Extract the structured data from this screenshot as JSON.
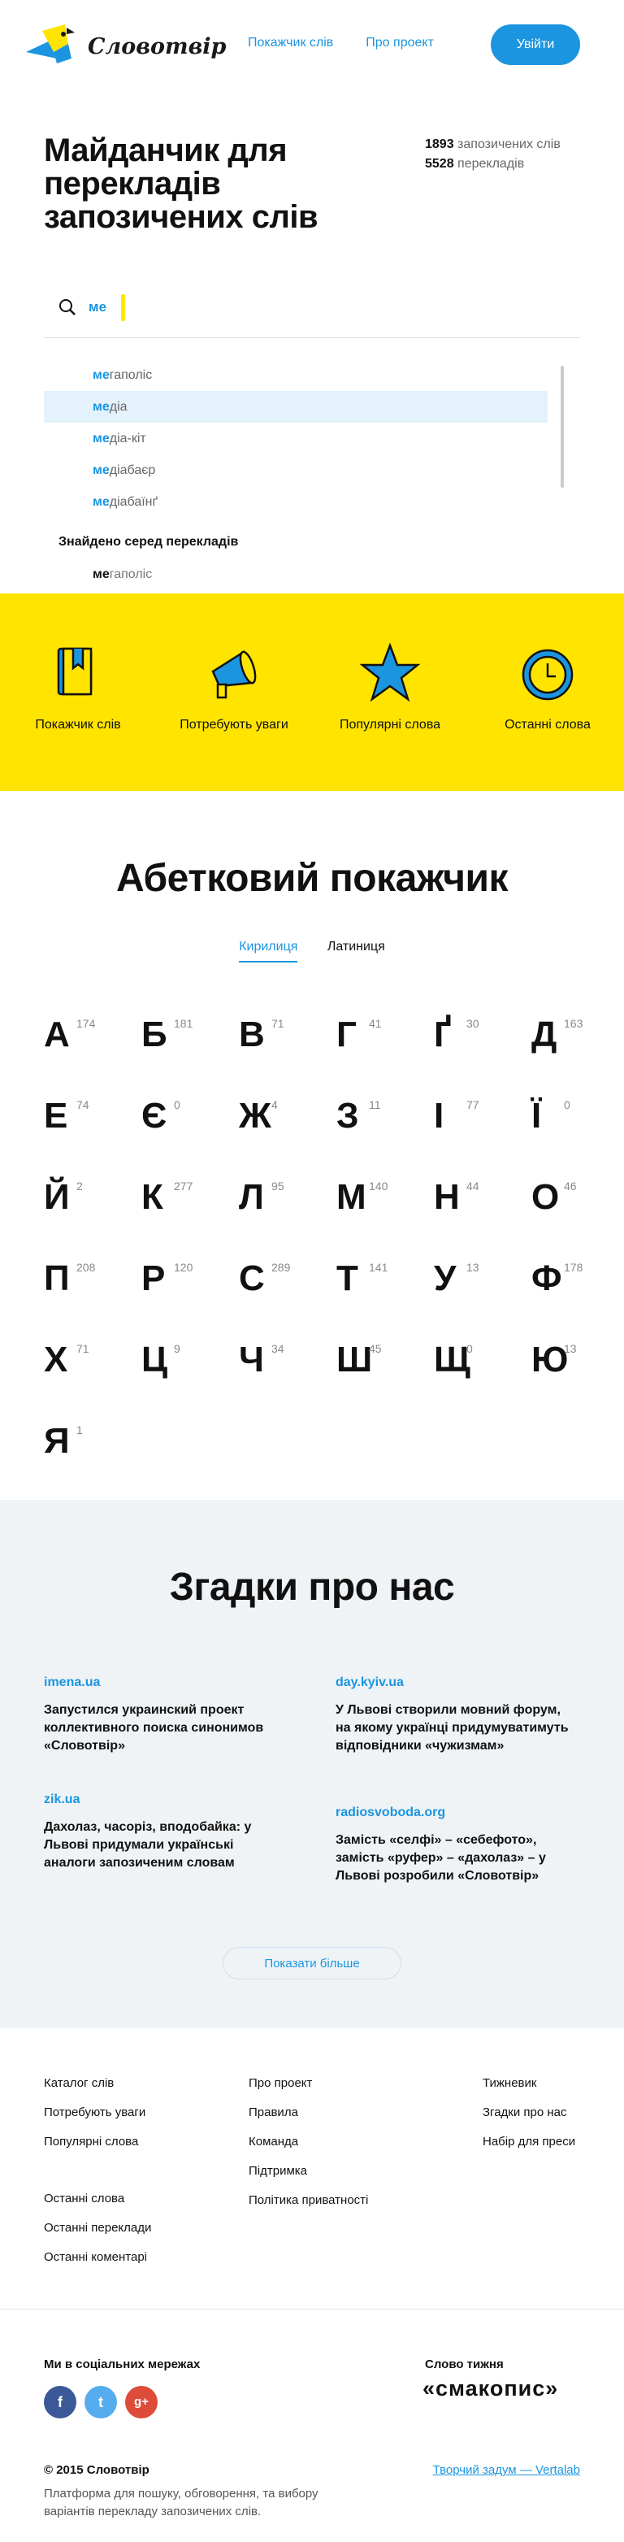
{
  "header": {
    "logo_text": "Словотвір",
    "nav": [
      "Покажчик слів",
      "Про проект"
    ],
    "login_label": "Увійти"
  },
  "hero": {
    "title": "Майданчик для перекладів запозичених слів",
    "stats": [
      {
        "count": "1893",
        "label": "запозичених слів"
      },
      {
        "count": "5528",
        "label": "перекладів"
      }
    ]
  },
  "search": {
    "value": "ме",
    "suggestions": [
      {
        "hl": "ме",
        "rest": "гаполіс"
      },
      {
        "hl": "ме",
        "rest": "діа"
      },
      {
        "hl": "ме",
        "rest": "діа-кіт"
      },
      {
        "hl": "ме",
        "rest": "діабаєр"
      },
      {
        "hl": "ме",
        "rest": "діабаїнґ"
      }
    ],
    "found_label": "Знайдено серед перекладів",
    "found_item": {
      "hl": "ме",
      "rest": "гаполіс"
    }
  },
  "features": [
    {
      "label": "Покажчик слів",
      "icon": "book-icon"
    },
    {
      "label": "Потребують уваги",
      "icon": "megaphone-icon"
    },
    {
      "label": "Популярні слова",
      "icon": "star-icon"
    },
    {
      "label": "Останні слова",
      "icon": "clock-icon"
    }
  ],
  "alphabet": {
    "title": "Абетковий покажчик",
    "tabs": [
      "Кирилиця",
      "Латиниця"
    ],
    "letters": [
      {
        "l": "А",
        "n": "174"
      },
      {
        "l": "Б",
        "n": "181"
      },
      {
        "l": "В",
        "n": "71"
      },
      {
        "l": "Г",
        "n": "41"
      },
      {
        "l": "Ґ",
        "n": "30"
      },
      {
        "l": "Д",
        "n": "163"
      },
      {
        "l": "Е",
        "n": "74"
      },
      {
        "l": "Є",
        "n": "0"
      },
      {
        "l": "Ж",
        "n": "4"
      },
      {
        "l": "З",
        "n": "11"
      },
      {
        "l": "І",
        "n": "77"
      },
      {
        "l": "Ї",
        "n": "0"
      },
      {
        "l": "Й",
        "n": "2"
      },
      {
        "l": "К",
        "n": "277"
      },
      {
        "l": "Л",
        "n": "95"
      },
      {
        "l": "М",
        "n": "140"
      },
      {
        "l": "Н",
        "n": "44"
      },
      {
        "l": "О",
        "n": "46"
      },
      {
        "l": "П",
        "n": "208"
      },
      {
        "l": "Р",
        "n": "120"
      },
      {
        "l": "С",
        "n": "289"
      },
      {
        "l": "Т",
        "n": "141"
      },
      {
        "l": "У",
        "n": "13"
      },
      {
        "l": "Ф",
        "n": "178"
      },
      {
        "l": "Х",
        "n": "71"
      },
      {
        "l": "Ц",
        "n": "9"
      },
      {
        "l": "Ч",
        "n": "34"
      },
      {
        "l": "Ш",
        "n": "45"
      },
      {
        "l": "Щ",
        "n": "0"
      },
      {
        "l": "Ю",
        "n": "13"
      },
      {
        "l": "Я",
        "n": "1"
      }
    ]
  },
  "mentions": {
    "title": "Згадки про нас",
    "items": [
      {
        "source": "imena.ua",
        "text": "Запустился украинский проект коллективного поиска синонимов «Словотвір»"
      },
      {
        "source": "day.kyiv.ua",
        "text": "У Львові створили мовний форум, на якому українці придумуватимуть відповідники «чужизмам»"
      },
      {
        "source": "zik.ua",
        "text": "Дахолаз, часоріз, вподобайка: у Львові придумали українські аналоги запозиченим словам"
      },
      {
        "source": "radiosvoboda.org",
        "text": "Замість «селфі» – «себефото», замість «руфер» – «дахолаз» – у Львові розробили «Словотвір»"
      }
    ],
    "more_label": "Показати більше"
  },
  "footer": {
    "col1a": [
      "Каталог слів",
      "Потребують уваги",
      "Популярні слова"
    ],
    "col1b": [
      "Останні слова",
      "Останні переклади",
      "Останні коментарі"
    ],
    "col2": [
      "Про проект",
      "Правила",
      "Команда",
      "Підтримка",
      "Політика приватності"
    ],
    "col3": [
      "Тижневик",
      "Згадки про нас",
      "Набір для преси"
    ],
    "social_label": "Ми в соціальних мережах",
    "social": [
      "f",
      "t",
      "g+"
    ],
    "word_label": "Слово тижня",
    "word": "«смакопис»",
    "copyright": "© 2015 Словотвір",
    "description": "Платформа для пошуку, обговорення, та вибору варіантів перекладу запозичених слів.",
    "credit": "Творчий задум — Vertalab"
  },
  "colors": {
    "accent": "#1b95e0",
    "yellow": "#ffe400",
    "band": "#eff3f6"
  }
}
